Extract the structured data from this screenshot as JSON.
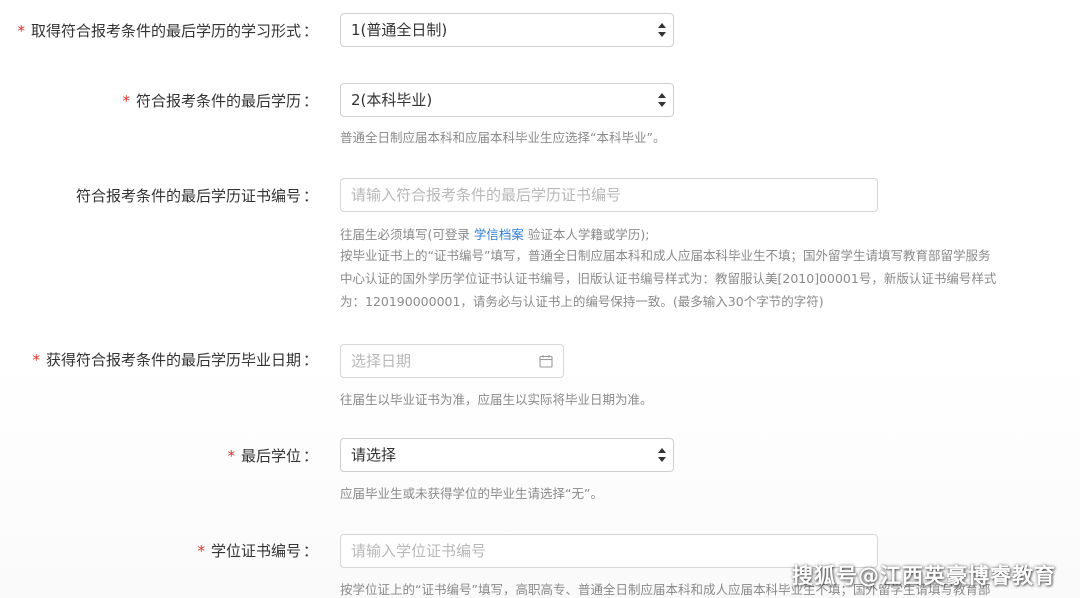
{
  "form": {
    "study_form": {
      "label": "取得符合报考条件的最后学历的学习形式",
      "value": "1(普通全日制)",
      "required_mark": "*"
    },
    "last_education": {
      "label": "符合报考条件的最后学历",
      "value": "2(本科毕业)",
      "required_mark": "*",
      "hint": "普通全日制应届本科和应届本科毕业生应选择“本科毕业”。"
    },
    "certificate_number": {
      "label": "符合报考条件的最后学历证书编号",
      "placeholder": "请输入符合报考条件的最后学历证书编号",
      "hint_line1_pre": "往届生必须填写(可登录",
      "hint_link": "学信档案",
      "hint_line1_post": "验证本人学籍或学历);",
      "hint_line2": "按毕业证书上的“证书编号”填写，普通全日制应届本科和成人应届本科毕业生不填；国外留学生请填写教育部留学服务",
      "hint_line3": "中心认证的国外学历学位证书认证书编号，旧版认证书编号样式为：教留服认美[2010]00001号，新版认证书编号样式",
      "hint_line4": "为：120190000001，请务必与认证书上的编号保持一致。(最多输入30个字节的字符)"
    },
    "graduation_date": {
      "label": "获得符合报考条件的最后学历毕业日期",
      "placeholder": "选择日期",
      "required_mark": "*",
      "hint": "往届生以毕业证书为准，应届生以实际将毕业日期为准。"
    },
    "last_degree": {
      "label": "最后学位",
      "value": "请选择",
      "required_mark": "*",
      "hint": "应届毕业生或未获得学位的毕业生请选择“无”。"
    },
    "degree_certificate": {
      "label": "学位证书编号",
      "placeholder": "请输入学位证书编号",
      "required_mark": "*",
      "hint": "按学位证上的“证书编号”填写，高职高专、普通全日制应届本科和成人应届本科毕业生不填；国外留学生请填写教育部"
    },
    "colon": "："
  },
  "watermark": "搜狐号@江西英豪博睿教育",
  "colors": {
    "required": "#e0312b",
    "link": "#2f7fd0",
    "hint": "#8a8a8a",
    "label": "#333333",
    "border": "#cfcfcf"
  },
  "icons": {
    "select_arrows": "up-down-arrows-icon",
    "date_picker": "calendar-icon"
  }
}
